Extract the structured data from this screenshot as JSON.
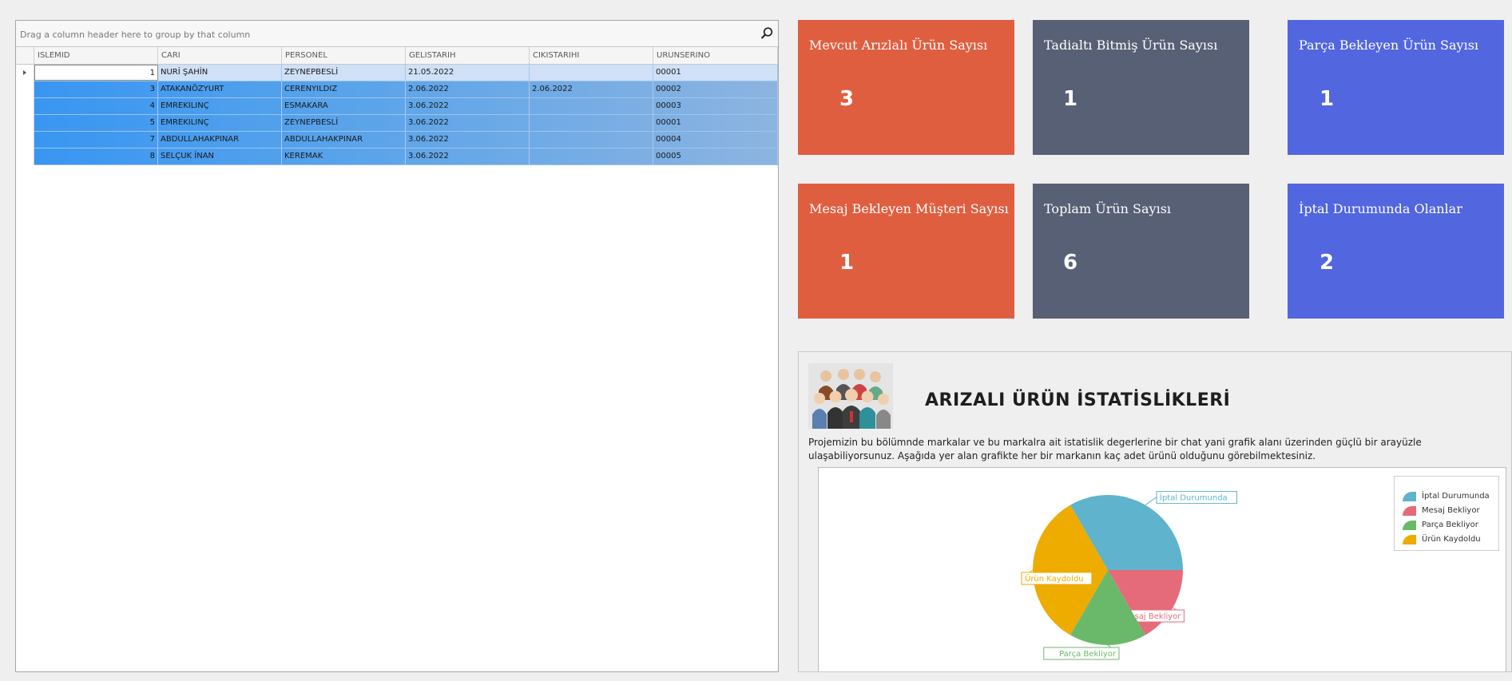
{
  "grid": {
    "group_panel_text": "Drag a column header here to group by that column",
    "search_icon": "search-icon",
    "columns": [
      "ISLEMID",
      "CARI",
      "PERSONEL",
      "GELISTARIH",
      "CIKISTARIHI",
      "URUNSERINO"
    ],
    "rows": [
      [
        "1",
        "NURİ ŞAHİN",
        "ZEYNEPBESLİ",
        "21.05.2022",
        "",
        "00001"
      ],
      [
        "3",
        "ATAKANÖZYURT",
        "CERENYILDIZ",
        "2.06.2022",
        "2.06.2022",
        "00002"
      ],
      [
        "4",
        "EMREKILINÇ",
        "ESMAKARA",
        "3.06.2022",
        "",
        "00003"
      ],
      [
        "5",
        "EMREKILINÇ",
        "ZEYNEPBESLİ",
        "3.06.2022",
        "",
        "00001"
      ],
      [
        "7",
        "ABDULLAHAKPINAR",
        "ABDULLAHAKPINAR",
        "3.06.2022",
        "",
        "00004"
      ],
      [
        "8",
        "SELÇUK İNAN",
        "KEREMAK",
        "3.06.2022",
        "",
        "00005"
      ]
    ]
  },
  "tiles": [
    {
      "title": "Mevcut Arızlalı Ürün Sayısı",
      "value": "3",
      "color": "#e05e40"
    },
    {
      "title": "Tadialtı Bitmiş Ürün Sayısı",
      "value": "1",
      "color": "#586075"
    },
    {
      "title": "Parça Bekleyen Ürün Sayısı",
      "value": "1",
      "color": "#5266e0"
    },
    {
      "title": "Mesaj Bekleyen Müşteri Sayısı",
      "value": "1",
      "color": "#e05e40"
    },
    {
      "title": "Toplam Ürün Sayısı",
      "value": "6",
      "color": "#586075"
    },
    {
      "title": "İptal Durumunda Olanlar",
      "value": "2",
      "color": "#5266e0"
    }
  ],
  "stats": {
    "title": "ARIZALI ÜRÜN İSTATİSLİKLERİ",
    "description": "Projemizin bu bölümnde markalar ve bu markalra ait istatislik degerlerine bir chat yani grafik alanı üzerinden güçlü bir arayüzle ulaşabiliyorsunuz. Aşağıda yer alan grafikte her bir markanın kaç adet ürünü olduğunu görebilmektesiniz.",
    "image_icon": "people-group-image"
  },
  "chart_data": {
    "type": "pie",
    "categories": [
      "İptal Durumunda",
      "Mesaj Bekliyor",
      "Parça Bekliyor",
      "Ürün Kaydoldu"
    ],
    "values": [
      2,
      1,
      1,
      2
    ],
    "colors": [
      "#5fb3cc",
      "#e56b7a",
      "#6ab96a",
      "#eeab00"
    ],
    "legend_position": "top-right"
  }
}
